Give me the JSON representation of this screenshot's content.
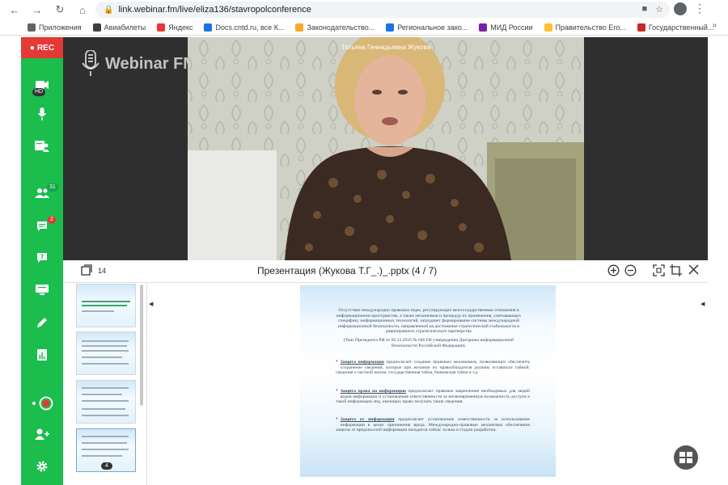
{
  "browser": {
    "url": "link.webinar.fm/live/eliza136/stavropolconference",
    "bookmarks": [
      {
        "label": "Приложения",
        "color": "#5f6368"
      },
      {
        "label": "Авиабилеты",
        "color": "#3c4043"
      },
      {
        "label": "Яндекс",
        "color": "#e53935"
      },
      {
        "label": "Docs.cntd.ru, все К...",
        "color": "#1a73e8"
      },
      {
        "label": "Законодательство...",
        "color": "#f9a825"
      },
      {
        "label": "Региональное зако...",
        "color": "#1a73e8"
      },
      {
        "label": "МИД России",
        "color": "#7b1fa2"
      },
      {
        "label": "Правительство Его...",
        "color": "#fbc02d"
      },
      {
        "label": "Государственный...",
        "color": "#c62828"
      }
    ],
    "more": "»"
  },
  "sidebar": {
    "rec_label": "REC",
    "camera_badge": "HD",
    "participants_count": "31",
    "chat_count": "2"
  },
  "app": {
    "logo_text": "Webinar FM",
    "speaker_name": "Татьяна Геннадьевна Жукова"
  },
  "presentation": {
    "slide_count": "14",
    "title": "Презентация (Жукова Т.Г_.)_.pptx (4 / 7)",
    "thumb_badge": "4"
  },
  "slide": {
    "intro": "Отсутствие международно правовых норм, регулирующих межгосударственные отношения в информационном пространстве, а также механизмов и процедур их применения, учитывающих специфику информационных технологий, затрудняет формирование системы международной информационной безопасности, направленной на достижение стратегической стабильности и равноправного стратегического партнерства",
    "decree": "(Указ Президента РФ от 05.12.2016 № 646 Об утверждении Доктрины информационной безопасности Российской Федерации).",
    "items": [
      {
        "term": "Защита информации",
        "text": " предполагает создание правовых механизмов, позволяющих обеспечить сохранение сведений, которые при желании их правообладателя должны оставаться тайной: сведения о частной жизни, государственная тайна, банковская тайна и т.д."
      },
      {
        "term": "Защита права на информацию",
        "text": " предполагает правовое закрепление необходимых для людей видов информации и установление ответственности за несвоевременную возможность доступа к такой информации лиц, имеющих право получать такие сведения."
      },
      {
        "term": "Защита от информации",
        "text": " предполагает установление ответственности за использование информации в целях причинения вреда. Международно-правовые механизмы обеспечения защиты от вредоносной информации находятся сейчас только в стадии разработки."
      }
    ]
  },
  "colors": {
    "sidebar": "#1bbd4d",
    "rec": "#e53935",
    "video_bg": "#2f2f2f"
  }
}
